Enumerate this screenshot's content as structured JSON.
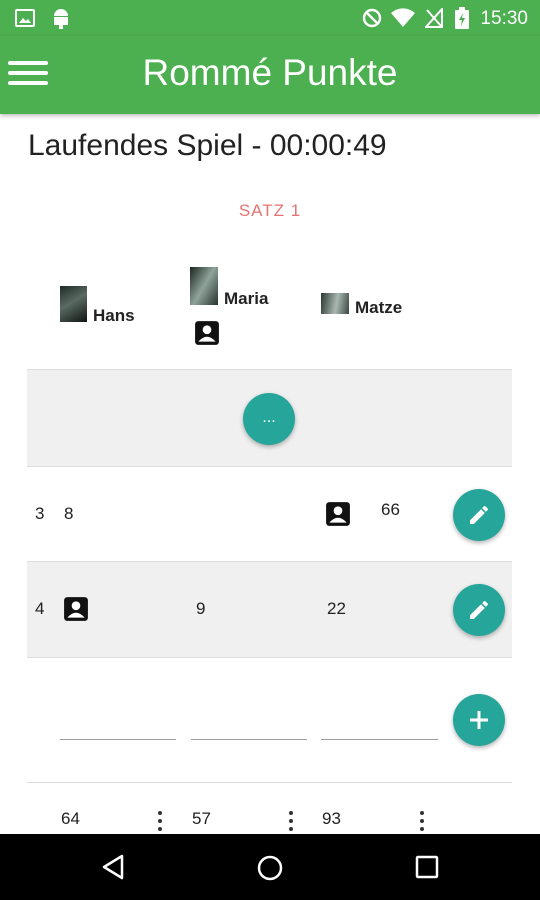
{
  "status_bar": {
    "time": "15:30"
  },
  "app_bar": {
    "title": "Rommé Punkte"
  },
  "game": {
    "title": "Laufendes Spiel - 00:00:49",
    "round_label": "SATZ 1"
  },
  "players": [
    {
      "name": "Hans"
    },
    {
      "name": "Maria"
    },
    {
      "name": "Matze"
    }
  ],
  "more_button": {
    "label": "..."
  },
  "rows": [
    {
      "round": "3",
      "values": [
        "8",
        "",
        "66"
      ]
    },
    {
      "round": "4",
      "values": [
        "",
        "9",
        "22"
      ]
    }
  ],
  "totals": [
    "64",
    "57",
    "93"
  ],
  "colors": {
    "primary": "#4caf50",
    "accent": "#26a69a",
    "round_label": "#e57373"
  },
  "icons": [
    "menu-icon",
    "contact-icon",
    "edit-icon",
    "add-icon",
    "more-vert-icon",
    "back-icon",
    "home-icon",
    "recents-icon"
  ]
}
